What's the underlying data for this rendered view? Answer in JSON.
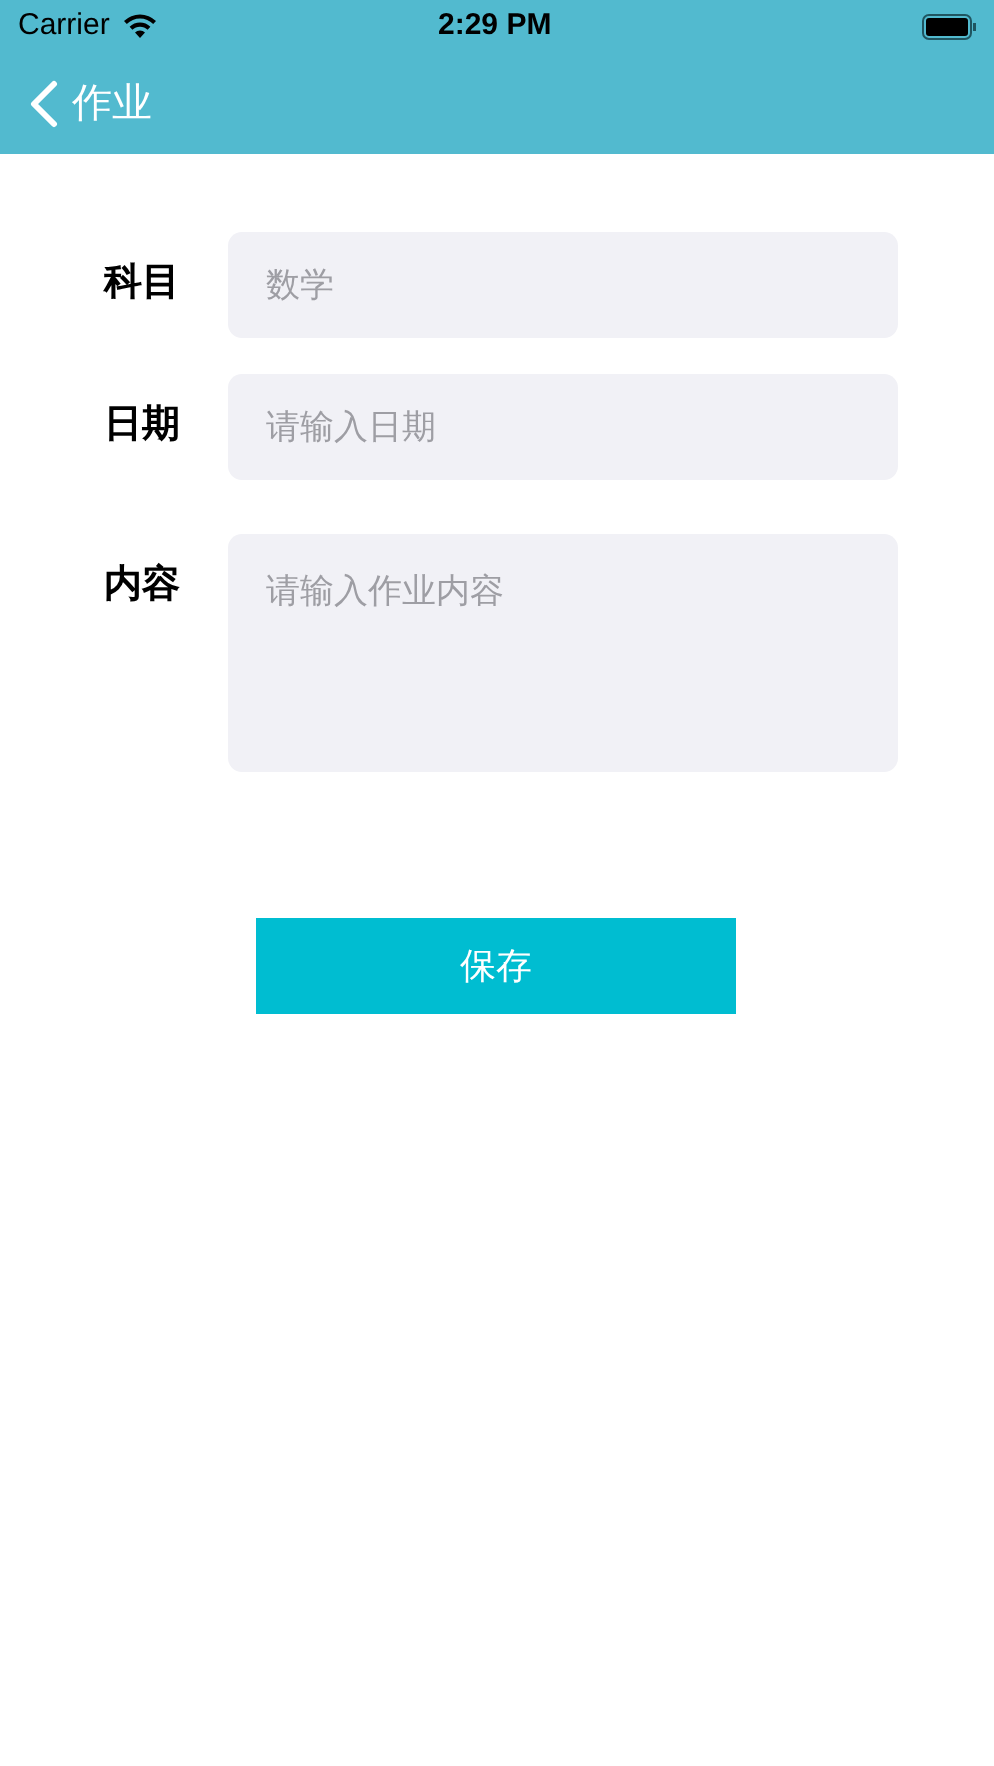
{
  "status_bar": {
    "carrier": "Carrier",
    "time": "2:29 PM"
  },
  "nav_bar": {
    "title": "作业"
  },
  "form": {
    "fields": [
      {
        "label": "科目",
        "kind": "input",
        "placeholder": "数学"
      },
      {
        "label": "日期",
        "kind": "input",
        "placeholder": "请输入日期"
      },
      {
        "label": "内容",
        "kind": "textarea",
        "placeholder": "请输入作业内容"
      }
    ]
  },
  "save_button": {
    "label": "保存"
  }
}
